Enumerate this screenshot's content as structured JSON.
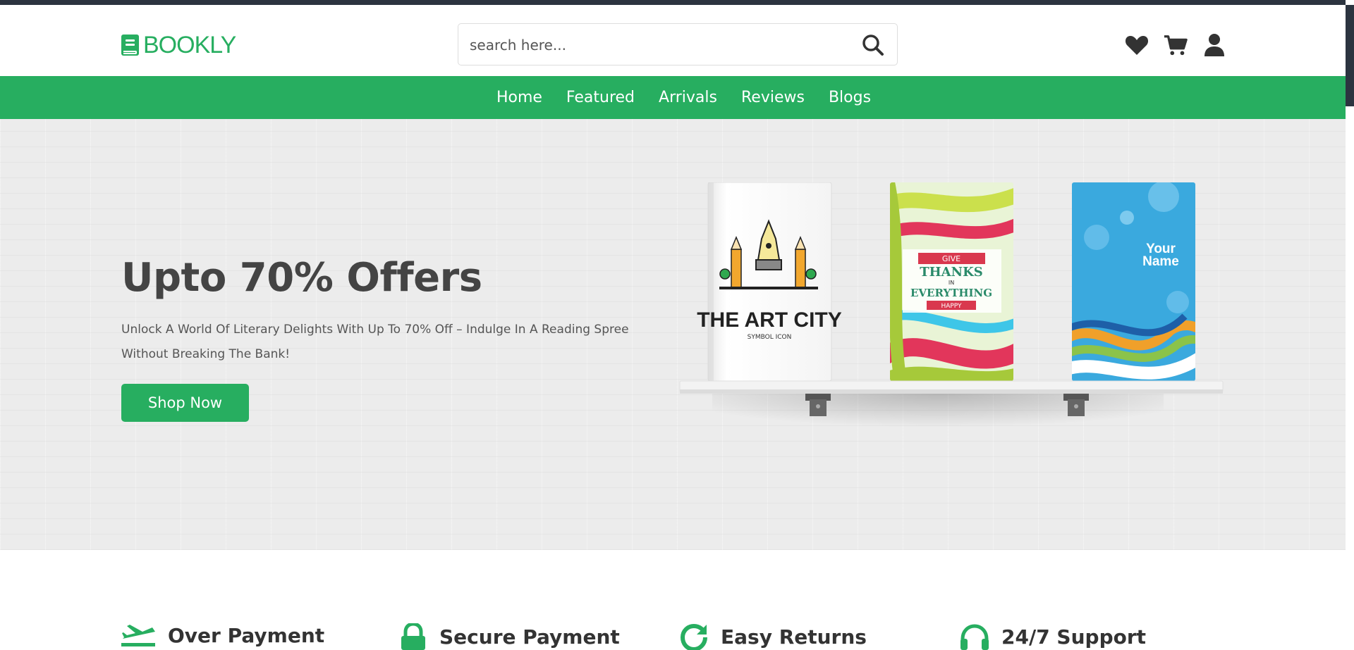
{
  "brand": {
    "name": "BOOKLY",
    "icon": "book-icon",
    "color": "#27ae60"
  },
  "search": {
    "placeholder": "search here...",
    "icon": "search-icon"
  },
  "header_icons": [
    {
      "name": "heart-icon"
    },
    {
      "name": "cart-icon"
    },
    {
      "name": "user-icon"
    }
  ],
  "nav": {
    "items": [
      {
        "label": "Home"
      },
      {
        "label": "Featured"
      },
      {
        "label": "Arrivals"
      },
      {
        "label": "Reviews"
      },
      {
        "label": "Blogs"
      }
    ]
  },
  "hero": {
    "title": "Upto 70% Offers",
    "description": "Unlock A World Of Literary Delights With Up To 70% Off – Indulge In A Reading Spree Without Breaking The Bank!",
    "cta_label": "Shop Now",
    "books": [
      {
        "title": "THE ART CITY",
        "subtitle": "SYMBOL ICON"
      },
      {
        "lines": [
          "GIVE",
          "THANKS",
          "IN",
          "EVERYTHING",
          "HAPPY"
        ]
      },
      {
        "lines": [
          "Your",
          "Name"
        ]
      }
    ]
  },
  "features": [
    {
      "title": "Over Payment",
      "icon": "plane-icon"
    },
    {
      "title": "Secure Payment",
      "icon": "lock-icon"
    },
    {
      "title": "Easy Returns",
      "icon": "redo-icon"
    },
    {
      "title": "24/7 Support",
      "icon": "headset-icon"
    }
  ],
  "colors": {
    "accent": "#27ae60",
    "dark": "#2c3440",
    "text": "#444444"
  }
}
